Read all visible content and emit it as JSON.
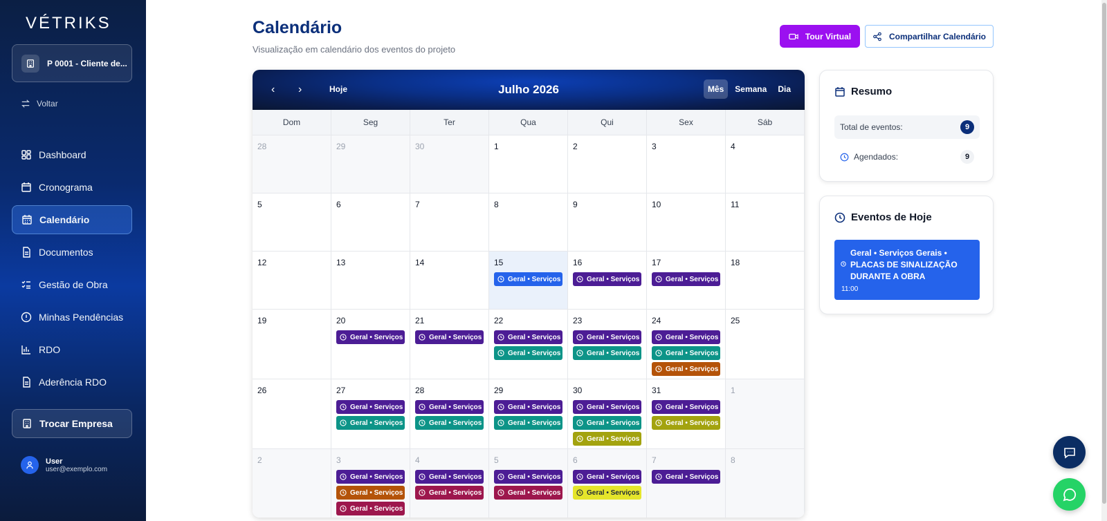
{
  "brand": {
    "logo": "VÉTRIKS"
  },
  "project": {
    "name": "P 0001 - Cliente de..."
  },
  "sidebar": {
    "back_label": "Voltar",
    "items": [
      {
        "label": "Dashboard",
        "icon": "dashboard-icon",
        "active": false
      },
      {
        "label": "Cronograma",
        "icon": "calendar-icon",
        "active": false
      },
      {
        "label": "Calendário",
        "icon": "calendar-grid-icon",
        "active": true
      },
      {
        "label": "Documentos",
        "icon": "document-icon",
        "active": false
      },
      {
        "label": "Gestão de Obra",
        "icon": "checklist-icon",
        "active": false
      },
      {
        "label": "Minhas Pendências",
        "icon": "alert-circle-icon",
        "active": false
      },
      {
        "label": "RDO",
        "icon": "bar-chart-icon",
        "active": false
      },
      {
        "label": "Aderência RDO",
        "icon": "document-icon",
        "active": false
      }
    ],
    "switch_company": "Trocar Empresa",
    "user": {
      "name": "User",
      "email": "user@exemplo.com"
    }
  },
  "header": {
    "title": "Calendário",
    "subtitle": "Visualização em calendário dos eventos do projeto",
    "tour_button": "Tour Virtual",
    "share_button": "Compartilhar Calendário"
  },
  "calendar": {
    "month_label": "Julho 2026",
    "today_button": "Hoje",
    "prev": "‹",
    "next": "›",
    "views": [
      {
        "label": "Mês",
        "active": true
      },
      {
        "label": "Semana",
        "active": false
      },
      {
        "label": "Dia",
        "active": false
      }
    ],
    "weekdays": [
      "Dom",
      "Seg",
      "Ter",
      "Qua",
      "Qui",
      "Sex",
      "Sáb"
    ],
    "event_label": "Geral • Serviços",
    "colors": {
      "purple": "#4c1d95",
      "teal": "#0d9488",
      "orange": "#b45309",
      "olive": "#a3a30f",
      "magenta": "#9d174d",
      "yellow": "#e5e52b",
      "blue": "#2563eb"
    },
    "weeks": [
      [
        {
          "d": "28",
          "other": true,
          "ev": []
        },
        {
          "d": "29",
          "other": true,
          "ev": []
        },
        {
          "d": "30",
          "other": true,
          "ev": []
        },
        {
          "d": "1",
          "ev": []
        },
        {
          "d": "2",
          "ev": []
        },
        {
          "d": "3",
          "ev": []
        },
        {
          "d": "4",
          "ev": []
        }
      ],
      [
        {
          "d": "5",
          "ev": []
        },
        {
          "d": "6",
          "ev": []
        },
        {
          "d": "7",
          "ev": []
        },
        {
          "d": "8",
          "ev": []
        },
        {
          "d": "9",
          "ev": []
        },
        {
          "d": "10",
          "ev": []
        },
        {
          "d": "11",
          "ev": []
        }
      ],
      [
        {
          "d": "12",
          "ev": []
        },
        {
          "d": "13",
          "ev": []
        },
        {
          "d": "14",
          "ev": []
        },
        {
          "d": "15",
          "today": true,
          "ev": [
            "blue"
          ]
        },
        {
          "d": "16",
          "ev": [
            "purple"
          ]
        },
        {
          "d": "17",
          "ev": [
            "purple"
          ]
        },
        {
          "d": "18",
          "ev": []
        }
      ],
      [
        {
          "d": "19",
          "ev": []
        },
        {
          "d": "20",
          "ev": [
            "purple"
          ]
        },
        {
          "d": "21",
          "ev": [
            "purple"
          ]
        },
        {
          "d": "22",
          "ev": [
            "purple",
            "teal"
          ]
        },
        {
          "d": "23",
          "ev": [
            "purple",
            "teal"
          ]
        },
        {
          "d": "24",
          "ev": [
            "purple",
            "teal",
            "orange"
          ]
        },
        {
          "d": "25",
          "ev": []
        }
      ],
      [
        {
          "d": "26",
          "ev": []
        },
        {
          "d": "27",
          "ev": [
            "purple",
            "teal"
          ]
        },
        {
          "d": "28",
          "ev": [
            "purple",
            "teal"
          ]
        },
        {
          "d": "29",
          "ev": [
            "purple",
            "teal"
          ]
        },
        {
          "d": "30",
          "ev": [
            "purple",
            "teal",
            "olive"
          ]
        },
        {
          "d": "31",
          "ev": [
            "purple",
            "olive"
          ]
        },
        {
          "d": "1",
          "other": true,
          "ev": []
        }
      ],
      [
        {
          "d": "2",
          "other": true,
          "ev": []
        },
        {
          "d": "3",
          "other": true,
          "ev": [
            "purple",
            "orange",
            "magenta"
          ]
        },
        {
          "d": "4",
          "other": true,
          "ev": [
            "purple",
            "magenta"
          ]
        },
        {
          "d": "5",
          "other": true,
          "ev": [
            "purple",
            "magenta"
          ]
        },
        {
          "d": "6",
          "other": true,
          "ev": [
            "purple",
            "yellow"
          ]
        },
        {
          "d": "7",
          "other": true,
          "ev": [
            "purple"
          ]
        },
        {
          "d": "8",
          "other": true,
          "ev": []
        }
      ]
    ]
  },
  "resumo": {
    "title": "Resumo",
    "total_label": "Total de eventos:",
    "total_value": "9",
    "scheduled_label": "Agendados:",
    "scheduled_value": "9"
  },
  "today_events": {
    "title": "Eventos de Hoje",
    "event_title": "Geral • Serviços Gerais • PLACAS DE SINALIZAÇÃO DURANTE A OBRA",
    "event_time": "11:00"
  }
}
